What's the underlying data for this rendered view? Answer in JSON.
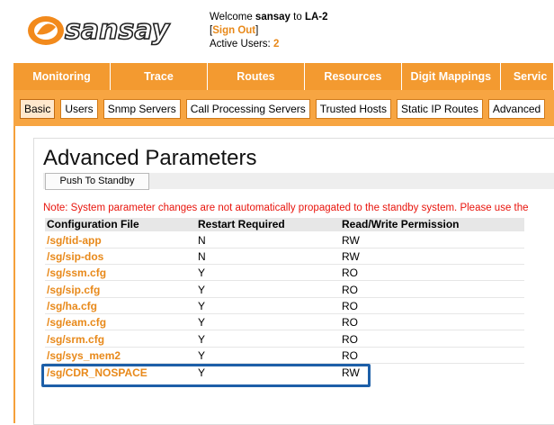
{
  "header": {
    "logo_text": "sansay",
    "welcome_prefix": "Welcome",
    "user": "sansay",
    "to_word": "to",
    "site": "LA-2",
    "sign_out": "Sign Out",
    "active_users_label": "Active Users:",
    "active_users": "2"
  },
  "main_nav": [
    "Monitoring",
    "Trace",
    "Routes",
    "Resources",
    "Digit Mappings",
    "Servic"
  ],
  "sub_nav": [
    "Basic",
    "Users",
    "Snmp Servers",
    "Call Processing Servers",
    "Trusted Hosts",
    "Static IP Routes",
    "Advanced"
  ],
  "active_sub_tab": "Basic",
  "page": {
    "title": "Advanced Parameters",
    "push_button": "Push To Standby",
    "note": "Note: System parameter changes are not automatically propagated to the standby system. Please use the"
  },
  "table": {
    "headers": [
      "Configuration File",
      "Restart Required",
      "Read/Write Permission"
    ],
    "rows": [
      [
        "/sg/tid-app",
        "N",
        "RW"
      ],
      [
        "/sg/sip-dos",
        "N",
        "RW"
      ],
      [
        "/sg/ssm.cfg",
        "Y",
        "RO"
      ],
      [
        "/sg/sip.cfg",
        "Y",
        "RO"
      ],
      [
        "/sg/ha.cfg",
        "Y",
        "RO"
      ],
      [
        "/sg/eam.cfg",
        "Y",
        "RO"
      ],
      [
        "/sg/srm.cfg",
        "Y",
        "RO"
      ],
      [
        "/sg/sys_mem2",
        "Y",
        "RO"
      ],
      [
        "/sg/CDR_NOSPACE",
        "Y",
        "RW"
      ]
    ]
  },
  "colors": {
    "nav_orange": "#f39a30",
    "link_orange": "#e8891a",
    "note_red": "#e8140c",
    "highlight_blue": "#1d5fa8"
  }
}
